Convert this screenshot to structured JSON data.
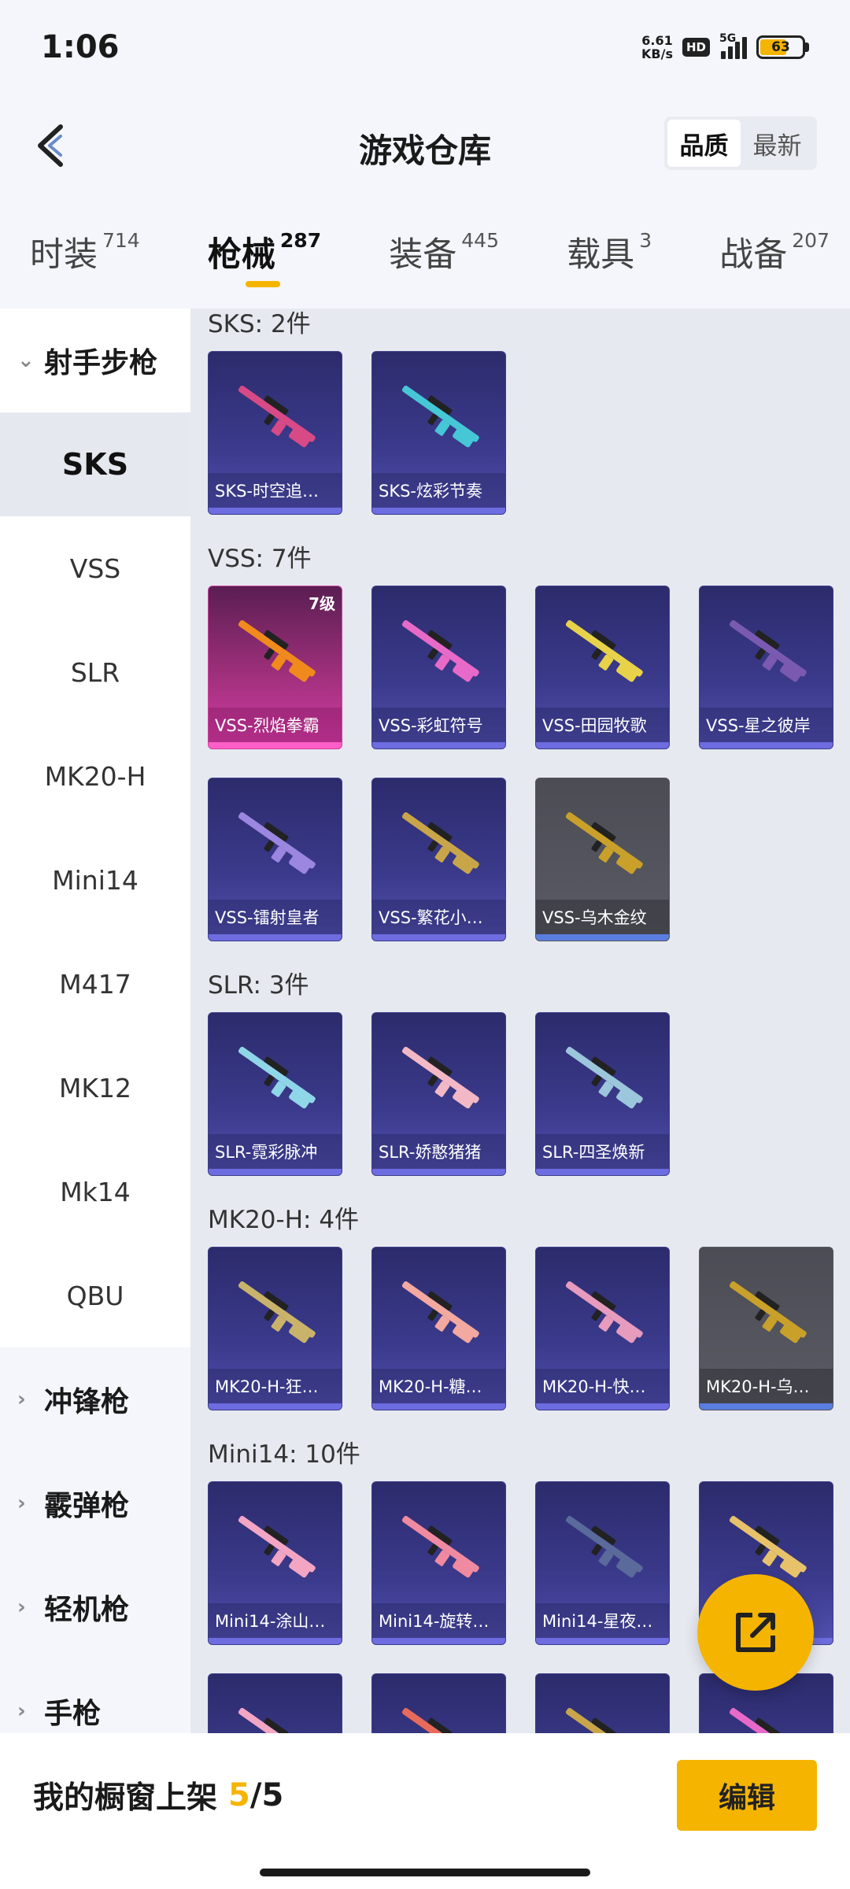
{
  "status": {
    "time": "1:06",
    "net_speed_value": "6.61",
    "net_speed_unit": "KB/s",
    "hd": "HD",
    "network": "5G",
    "battery": "63",
    "battery_fill": 0.63
  },
  "header": {
    "title": "游戏仓库",
    "sort_options": [
      "品质",
      "最新"
    ],
    "active_sort": "品质"
  },
  "tabs": [
    {
      "label": "时装",
      "count": "714"
    },
    {
      "label": "枪械",
      "count": "287"
    },
    {
      "label": "装备",
      "count": "445"
    },
    {
      "label": "载具",
      "count": "3"
    },
    {
      "label": "战备",
      "count": "207"
    }
  ],
  "active_tab": "枪械",
  "sidebar": {
    "open_category": "射手步枪",
    "subitems": [
      "SKS",
      "VSS",
      "SLR",
      "MK20-H",
      "Mini14",
      "M417",
      "MK12",
      "Mk14",
      "QBU"
    ],
    "active_subitem": "SKS",
    "collapsed_categories": [
      "冲锋枪",
      "霰弹枪",
      "轻机枪",
      "手枪"
    ]
  },
  "groups": [
    {
      "title": "SKS: 2件",
      "items": [
        {
          "name": "SKS-时空追…",
          "style": "purple",
          "gun_color": "#d84a86"
        },
        {
          "name": "SKS-炫彩节奏",
          "style": "purple",
          "gun_color": "#45c7d6"
        }
      ]
    },
    {
      "title": "VSS: 7件",
      "items": [
        {
          "name": "VSS-烈焰拳霸",
          "style": "pink",
          "level": "7级",
          "gun_color": "#f08a1c"
        },
        {
          "name": "VSS-彩虹符号",
          "style": "purple",
          "gun_color": "#e86ac8"
        },
        {
          "name": "VSS-田园牧歌",
          "style": "purple",
          "gun_color": "#e8d24a"
        },
        {
          "name": "VSS-星之彼岸",
          "style": "purple",
          "gun_color": "#7a5ab0"
        },
        {
          "name": "VSS-镭射皇者",
          "style": "purple",
          "gun_color": "#9b86e0"
        },
        {
          "name": "VSS-繁花小…",
          "style": "purple",
          "gun_color": "#c9a54a"
        },
        {
          "name": "VSS-乌木金纹",
          "style": "gray",
          "gun_color": "#c9a02a"
        }
      ]
    },
    {
      "title": "SLR: 3件",
      "items": [
        {
          "name": "SLR-霓彩脉冲",
          "style": "purple",
          "gun_color": "#8fd6e8"
        },
        {
          "name": "SLR-娇憨猪猪",
          "style": "purple",
          "gun_color": "#f3b8c6"
        },
        {
          "name": "SLR-四圣焕新",
          "style": "purple",
          "gun_color": "#9cc6dc"
        }
      ]
    },
    {
      "title": "MK20-H: 4件",
      "items": [
        {
          "name": "MK20-H-狂…",
          "style": "purple",
          "gun_color": "#c9b36a"
        },
        {
          "name": "MK20-H-糖…",
          "style": "purple",
          "gun_color": "#f3a9a0"
        },
        {
          "name": "MK20-H-快…",
          "style": "purple",
          "gun_color": "#e79bbd"
        },
        {
          "name": "MK20-H-乌…",
          "style": "gray",
          "gun_color": "#c9a02a"
        }
      ]
    },
    {
      "title": "Mini14: 10件",
      "items": [
        {
          "name": "Mini14-涂山…",
          "style": "purple",
          "gun_color": "#f2a6c4"
        },
        {
          "name": "Mini14-旋转…",
          "style": "purple",
          "gun_color": "#f08aa0"
        },
        {
          "name": "Mini14-星夜…",
          "style": "purple",
          "gun_color": "#5a6a9a"
        },
        {
          "name": "",
          "style": "purple",
          "gun_color": "#e8c26a"
        },
        {
          "name": "",
          "style": "purple",
          "gun_color": "#f2a6c4"
        },
        {
          "name": "",
          "style": "purple",
          "gun_color": "#e86a5a"
        },
        {
          "name": "",
          "style": "purple",
          "gun_color": "#c9a54a"
        },
        {
          "name": "",
          "style": "purple",
          "gun_color": "#e86ac8"
        }
      ]
    }
  ],
  "bottom": {
    "label": "我的橱窗上架",
    "current": "5",
    "separator": "/",
    "max": "5",
    "edit_label": "编辑"
  },
  "colors": {
    "accent": "#f5b400",
    "card_purple": "#3b3a8c",
    "card_gray": "#5a5b64",
    "card_pink": "#d43ca5"
  }
}
